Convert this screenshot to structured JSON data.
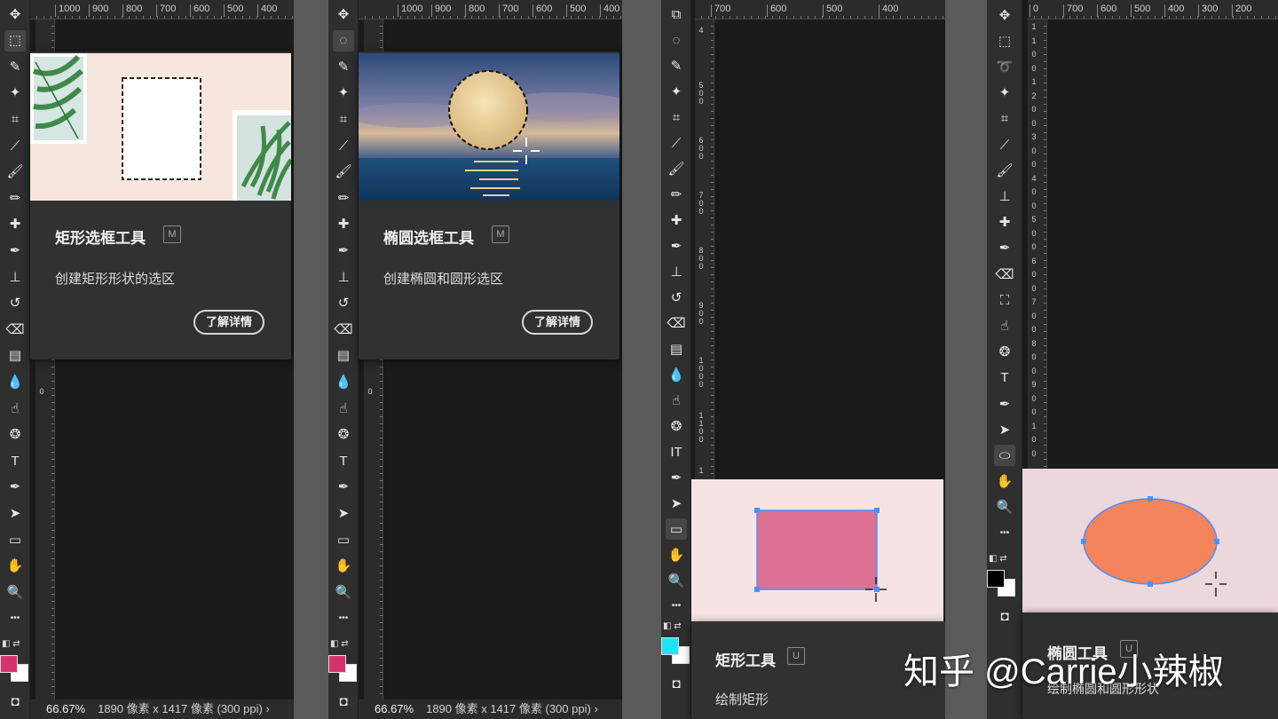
{
  "colors": {
    "panel_bg": "#1b1b1b",
    "toolbar_bg": "#2f2f2f",
    "tooltip_bg": "#313131",
    "p1_foreground": "#d6336c",
    "p2_foreground": "#d6336c",
    "p3_foreground": "#22e3f2",
    "p4_foreground": "#000000",
    "rect_fill": "#dc7192",
    "ellipse_fill": "#f4845c",
    "shape_outline": "#4f8ef7",
    "demo_bg_pink": "#f6e4e4",
    "demo_bg_mauve": "#ecd7dd"
  },
  "panel1": {
    "ruler": [
      "1000",
      "900",
      "800",
      "700",
      "600",
      "500",
      "400"
    ],
    "ruler_v": [
      "0"
    ],
    "tooltip": {
      "title": "矩形选框工具",
      "shortcut": "M",
      "description": "创建矩形形状的选区",
      "learn_more": "了解详情",
      "preview": "wall-frames-with-palm-leaves-dashed-rectangle"
    },
    "status": {
      "zoom": "66.67%",
      "doc_info": "1890 像素 x 1417 像素 (300 ppi)",
      "arrow": "›"
    },
    "selected_tool": "rectangular-marquee-icon"
  },
  "panel2": {
    "ruler": [
      "1000",
      "900",
      "800",
      "700",
      "600",
      "500",
      "400"
    ],
    "ruler_v": [
      "0"
    ],
    "tooltip": {
      "title": "椭圆选框工具",
      "shortcut": "M",
      "description": "创建椭圆和圆形选区",
      "learn_more": "了解详情",
      "preview": "full-moon-over-sea-dashed-circle"
    },
    "status": {
      "zoom": "66.67%",
      "doc_info": "1890 像素 x 1417 像素 (300 ppi)",
      "arrow": "›"
    },
    "selected_tool": "elliptical-marquee-icon"
  },
  "panel3": {
    "ruler": [
      "700",
      "600",
      "500",
      "400"
    ],
    "ruler_v": [
      "4",
      "500",
      "600",
      "700",
      "800",
      "900",
      "1000",
      "1100",
      "1"
    ],
    "tooltip": {
      "title": "矩形工具",
      "shortcut": "U",
      "description": "绘制矩形"
    },
    "selected_tool": "rectangle-tool-icon"
  },
  "panel4": {
    "ruler": [
      "0",
      "700",
      "600",
      "500",
      "400",
      "300",
      "200"
    ],
    "ruler_v": [
      "1",
      "1",
      "0",
      "0",
      "1",
      "2",
      "0",
      "0",
      "3",
      "0",
      "0",
      "4",
      "0",
      "0",
      "5",
      "0",
      "0",
      "6",
      "0",
      "0",
      "7",
      "0",
      "0",
      "8",
      "0",
      "0",
      "9",
      "0",
      "0",
      "1",
      "0",
      "0"
    ],
    "tooltip": {
      "title": "椭圆工具",
      "shortcut": "U",
      "description": "绘制椭圆和圆形形状"
    },
    "selected_tool": "ellipse-tool-icon"
  },
  "watermark": "知乎 @Carrie小辣椒"
}
